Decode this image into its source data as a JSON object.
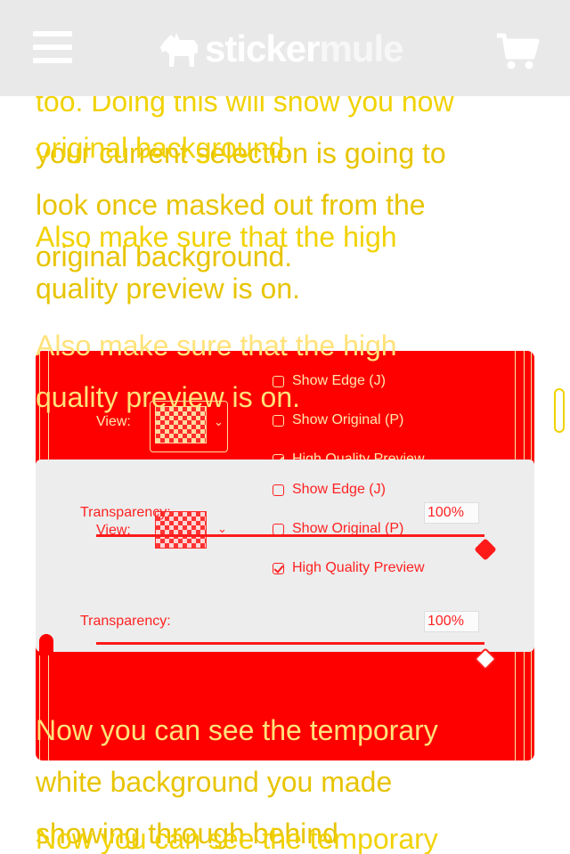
{
  "header": {
    "brand_primary": "sticker",
    "brand_secondary": "mule",
    "menu_icon": "hamburger-menu-icon",
    "cart_icon": "shopping-cart-icon",
    "logo_icon": "mule-logo-icon",
    "background_color": "#e9e9e9"
  },
  "article": {
    "text_color": "#e8c400",
    "lines_a": [
      "too. Doing this will show you how",
      "your current selection is going to",
      "look once masked out from the",
      "original background."
    ],
    "lines_b": [
      "Also make sure that the high",
      "quality preview is on."
    ],
    "lines_c": [
      "Now you can see the temporary",
      "white background you made",
      "showing through behind"
    ],
    "ghost_lines": [
      "original background.",
      "Also make sure that the high",
      "quality preview is on.",
      "Now you can see the temporary"
    ]
  },
  "dialog": {
    "view_label": "View:",
    "show_edge": "Show Edge (J)",
    "show_original": "Show Original (P)",
    "high_quality": "High Quality Preview",
    "transparency_label": "Transparency:",
    "transparency_value": "100%",
    "show_edge_checked": false,
    "show_original_checked": false,
    "high_quality_checked": true,
    "transparency_level": 1.0
  },
  "colors": {
    "panel": "#ff0000",
    "dialog_light": "#ededed",
    "accent": "#ff1a1a"
  }
}
